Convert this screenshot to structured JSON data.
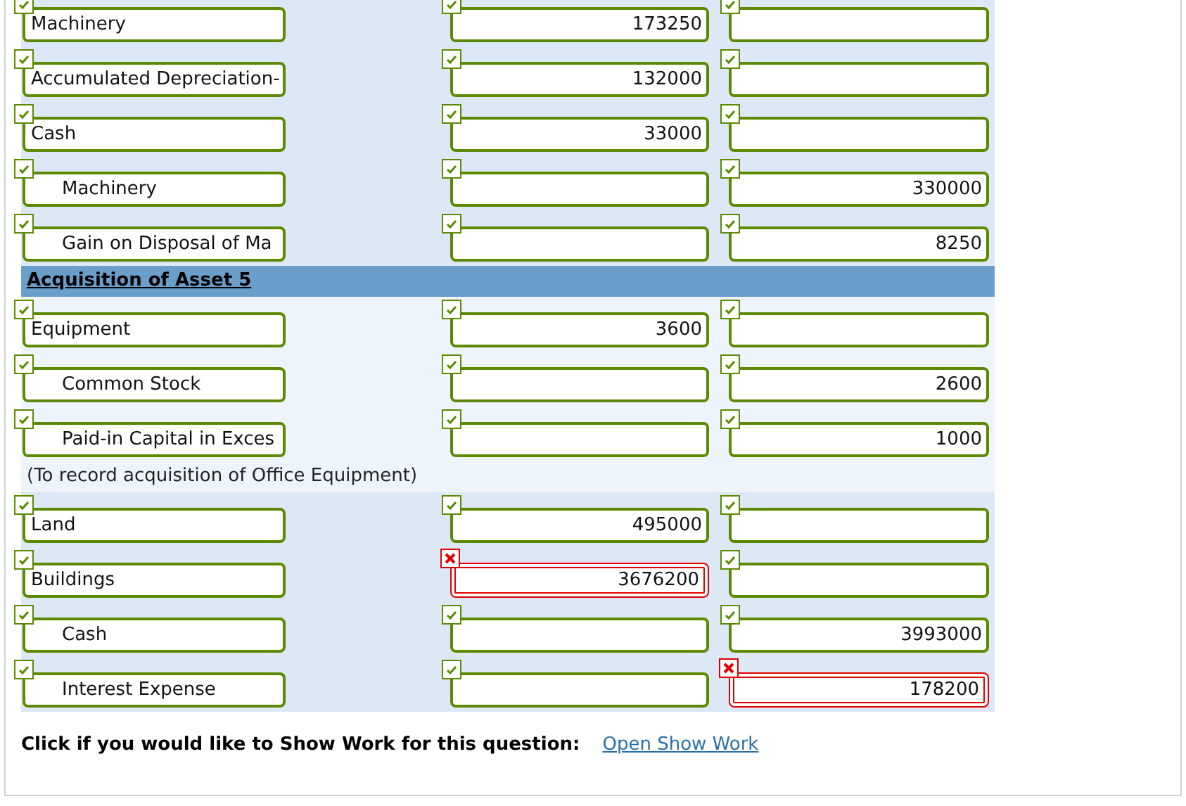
{
  "sections": [
    {
      "kind": "entries",
      "highlighted": true,
      "rows": [
        {
          "account": "Machinery",
          "indented": false,
          "account_correct": true,
          "debit": "173250",
          "debit_correct": true,
          "credit_correct": true
        },
        {
          "account": "Accumulated Depreciation-",
          "indented": false,
          "account_correct": true,
          "debit": "132000",
          "debit_correct": true,
          "credit_correct": true
        },
        {
          "account": "Cash",
          "indented": false,
          "account_correct": true,
          "debit": "33000",
          "debit_correct": true,
          "credit_correct": true
        },
        {
          "account": "Machinery",
          "indented": true,
          "account_correct": true,
          "debit_correct": true,
          "credit": "330000",
          "credit_correct": true
        },
        {
          "account": "Gain on Disposal of Ma",
          "indented": true,
          "account_correct": true,
          "debit_correct": true,
          "credit": "8250",
          "credit_correct": true
        }
      ]
    },
    {
      "kind": "heading",
      "text": "Acquisition of Asset 5"
    },
    {
      "kind": "entries",
      "highlighted": false,
      "rows": [
        {
          "account": "Equipment",
          "indented": false,
          "account_correct": true,
          "debit": "3600",
          "debit_correct": true,
          "credit_correct": true
        },
        {
          "account": "Common Stock",
          "indented": true,
          "account_correct": true,
          "debit_correct": true,
          "credit": "2600",
          "credit_correct": true
        },
        {
          "account": "Paid-in Capital in Exces",
          "indented": true,
          "account_correct": true,
          "debit_correct": true,
          "credit": "1000",
          "credit_correct": true
        }
      ]
    },
    {
      "kind": "note",
      "text": "(To record acquisition of Office Equipment)"
    },
    {
      "kind": "entries",
      "highlighted": true,
      "rows": [
        {
          "account": "Land",
          "indented": false,
          "account_correct": true,
          "debit": "495000",
          "debit_correct": true,
          "credit_correct": true
        },
        {
          "account": "Buildings",
          "indented": false,
          "account_correct": true,
          "debit": "3676200",
          "debit_correct": false,
          "credit_correct": true
        },
        {
          "account": "Cash",
          "indented": true,
          "account_correct": true,
          "debit_correct": true,
          "credit": "3993000",
          "credit_correct": true
        },
        {
          "account": "Interest Expense",
          "indented": true,
          "account_correct": true,
          "debit_correct": true,
          "credit": "178200",
          "credit_correct": false
        }
      ]
    }
  ],
  "footer": {
    "prompt": "Click if you would like to Show Work for this question:",
    "link": "Open Show Work"
  }
}
